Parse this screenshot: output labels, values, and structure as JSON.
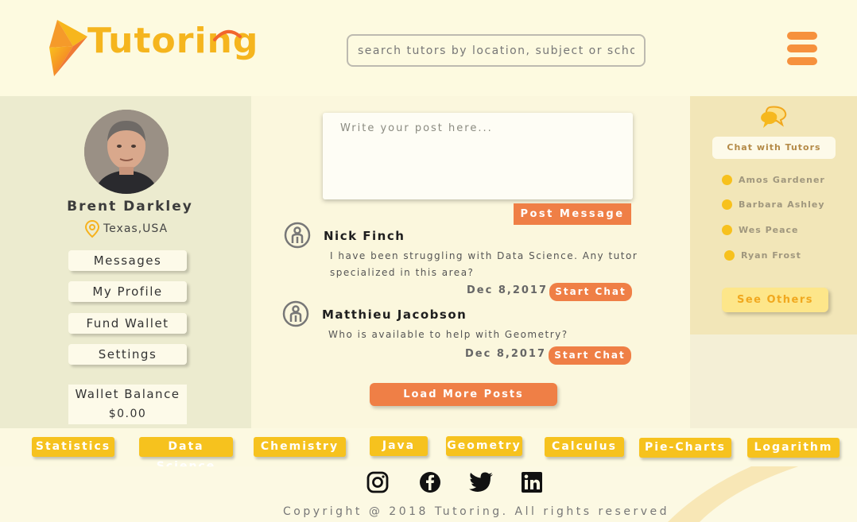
{
  "header": {
    "logo_text": "Tutoring",
    "search_placeholder": "search tutors by location, subject or school"
  },
  "profile": {
    "name": "Brent Darkley",
    "location": "Texas,USA",
    "menu": [
      "Messages",
      "My Profile",
      "Fund Wallet",
      "Settings"
    ],
    "wallet_title": "Wallet Balance",
    "wallet_value": "$0.00"
  },
  "feed": {
    "post_placeholder": "Write your post here...",
    "post_button": "Post Message",
    "posts": [
      {
        "author": "Nick Finch",
        "text_line1": "I have been struggling with Data Science. Any tutor",
        "text_line2": "specialized in this area?",
        "date": "Dec 8,2017",
        "chat_label": "Start Chat"
      },
      {
        "author": "Matthieu Jacobson",
        "text_line1": "Who is available to help with Geometry?",
        "text_line2": "",
        "date": "Dec 8,2017",
        "chat_label": "Start Chat"
      }
    ],
    "load_more": "Load More Posts"
  },
  "chat": {
    "title": "Chat with Tutors",
    "tutors": [
      "Amos Gardener",
      "Barbara Ashley",
      "Wes Peace",
      "Ryan Frost"
    ],
    "see_others": "See Others"
  },
  "tags": [
    "Statistics",
    "Data Science",
    "Chemistry",
    "Java",
    "Geometry",
    "Calculus",
    "Pie-Charts",
    "Logarithm"
  ],
  "footer": {
    "social": [
      "instagram-icon",
      "facebook-icon",
      "twitter-icon",
      "linkedin-icon"
    ],
    "copyright": "Copyright @ 2018 Tutoring. All rights reserved"
  },
  "colors": {
    "accent_orange": "#ef7f46",
    "accent_yellow": "#f6c21e",
    "background": "#fbf7dd"
  }
}
